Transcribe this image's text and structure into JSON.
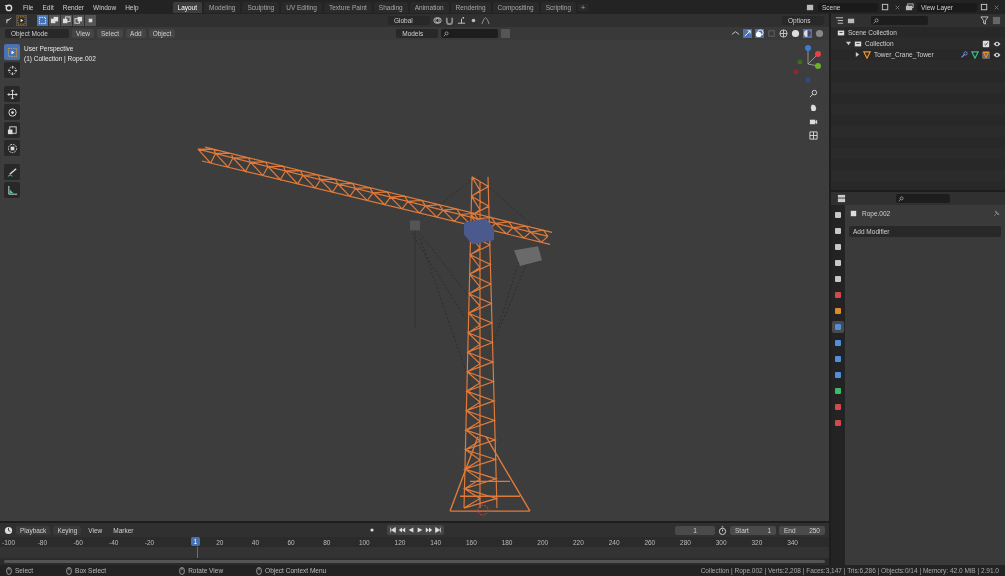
{
  "menu": [
    "File",
    "Edit",
    "Render",
    "Window",
    "Help"
  ],
  "workspaces": [
    {
      "label": "Layout",
      "selected": true
    },
    {
      "label": "Modeling",
      "selected": false
    },
    {
      "label": "Sculpting",
      "selected": false
    },
    {
      "label": "UV Editing",
      "selected": false
    },
    {
      "label": "Texture Paint",
      "selected": false
    },
    {
      "label": "Shading",
      "selected": false
    },
    {
      "label": "Animation",
      "selected": false
    },
    {
      "label": "Rendering",
      "selected": false
    },
    {
      "label": "Compositing",
      "selected": false
    },
    {
      "label": "Scripting",
      "selected": false
    }
  ],
  "add_workspace": "+",
  "scene": "Scene",
  "view_layer": "View Layer",
  "viewport": {
    "transform_orientation": "Global",
    "options": "Options",
    "mode": "Object Mode",
    "menus": [
      "View",
      "Select",
      "Add",
      "Object"
    ],
    "collection_filter": "Models",
    "overlay_text": [
      "User Perspective",
      "(1) Collection | Rope.002"
    ],
    "tools": [
      {
        "kind": "select",
        "selected": true
      },
      {
        "kind": "cursor",
        "selected": false
      },
      {
        "kind": "move",
        "selected": false
      },
      {
        "kind": "rotate",
        "selected": false
      },
      {
        "kind": "scale",
        "selected": false
      },
      {
        "kind": "transform",
        "selected": false
      },
      {
        "kind": "annotate",
        "selected": false
      },
      {
        "kind": "measure",
        "selected": false
      }
    ]
  },
  "outliner": {
    "items": [
      {
        "label": "Scene Collection",
        "children": [
          {
            "label": "Collection",
            "expanded": true,
            "checked": true,
            "visible": true,
            "children": [
              {
                "label": "Tower_Crane_Tower",
                "expanded": false,
                "visible": true
              }
            ]
          }
        ]
      }
    ]
  },
  "properties": {
    "tabs": [
      {
        "color": "#c8c8c8",
        "selected": false
      },
      {
        "color": "#c8c8c8",
        "selected": false
      },
      {
        "color": "#c8c8c8",
        "selected": false
      },
      {
        "color": "#c8c8c8",
        "selected": false
      },
      {
        "color": "#c8c8c8",
        "selected": false
      },
      {
        "color": "#d04c4c",
        "selected": false
      },
      {
        "color": "#e08a2c",
        "selected": false
      },
      {
        "color": "#4f8fdc",
        "selected": true
      },
      {
        "color": "#4f8fdc",
        "selected": false
      },
      {
        "color": "#4f8fdc",
        "selected": false
      },
      {
        "color": "#4f8fdc",
        "selected": false
      },
      {
        "color": "#3dbb6a",
        "selected": false
      },
      {
        "color": "#d04c4c",
        "selected": false
      },
      {
        "color": "#d04c4c",
        "selected": false
      }
    ],
    "object": "Rope.002",
    "add_modifier": "Add Modifier"
  },
  "timeline": {
    "menus": [
      "Playback",
      "Keying",
      "View",
      "Marker"
    ],
    "current_frame": "1",
    "start_label": "Start",
    "start": "1",
    "end_label": "End",
    "end": "250",
    "playhead": "1",
    "ticks_before": [
      "-100",
      "-80",
      "-60",
      "-40",
      "-20"
    ],
    "ticks_after": [
      "20",
      "40",
      "60",
      "80",
      "100",
      "120",
      "140",
      "160",
      "180",
      "200",
      "220",
      "240",
      "260",
      "280",
      "300",
      "320",
      "340"
    ]
  },
  "status_bar": {
    "hints": [
      "Select",
      "Box Select",
      "Rotate View",
      "Object Context Menu"
    ],
    "stats": "Collection | Rope.002 | Verts:2,208 | Faces:3,147 | Tris:6,286 | Objects:0/14 | Memory: 42.0 MiB | 2.91.0"
  }
}
